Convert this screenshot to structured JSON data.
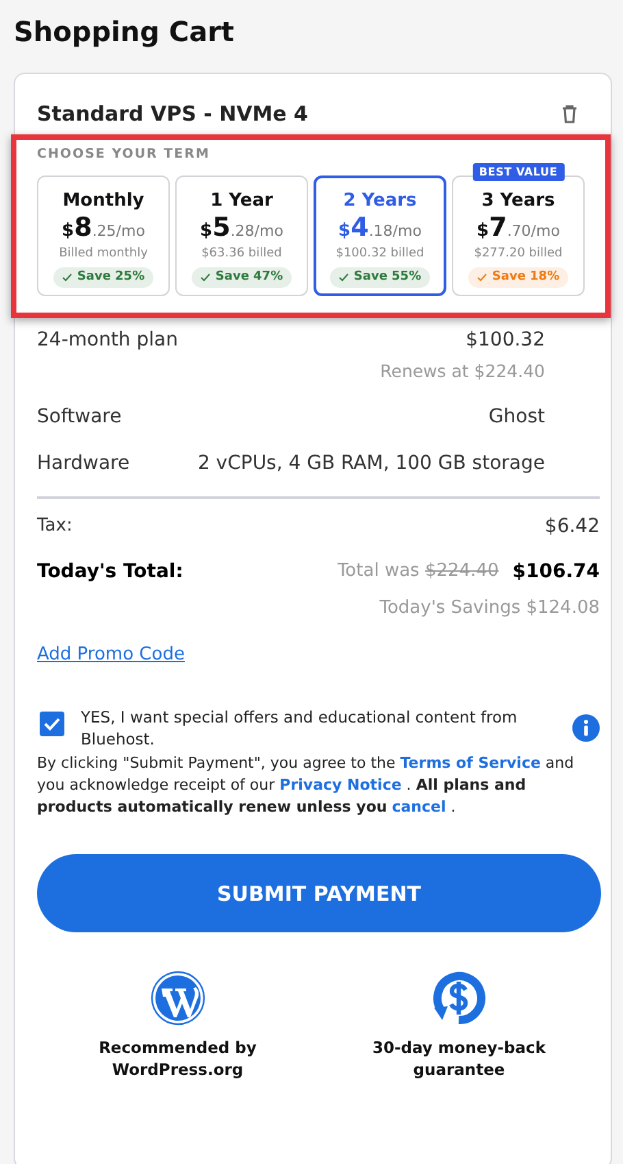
{
  "page_title": "Shopping Cart",
  "product": {
    "name": "Standard VPS - NVMe 4"
  },
  "term_section": {
    "label": "CHOOSE YOUR TERM",
    "highlighted": true
  },
  "terms": [
    {
      "name": "Monthly",
      "currency": "$",
      "whole": "8",
      "rest": ".25/mo",
      "billed": "Billed monthly",
      "savings": {
        "text": "Save 25%",
        "color": "#2e7a3c"
      },
      "selected": false
    },
    {
      "name": "1 Year",
      "currency": "$",
      "whole": "5",
      "rest": ".28/mo",
      "billed": "$63.36 billed",
      "savings": {
        "text": "Save 47%",
        "color": "#2e7a3c"
      },
      "selected": false
    },
    {
      "name": "2 Years",
      "currency": "$",
      "whole": "4",
      "rest": ".18/mo",
      "billed": "$100.32 billed",
      "savings": {
        "text": "Save 55%",
        "color": "#2e7a3c"
      },
      "selected": true
    },
    {
      "name": "3 Years",
      "currency": "$",
      "whole": "7",
      "rest": ".70/mo",
      "billed": "$277.20 billed",
      "savings": {
        "text": "Save 18%",
        "color": "#f07a12"
      },
      "selected": false,
      "badge": "BEST VALUE"
    }
  ],
  "details": [
    {
      "label": "24-month plan",
      "value": "$100.32",
      "note": "Renews at $224.40"
    },
    {
      "label": "Software",
      "value": "Ghost"
    },
    {
      "label": "Hardware",
      "value": "2 vCPUs, 4 GB RAM, 100 GB storage"
    }
  ],
  "tax": {
    "label": "Tax:",
    "value": "$6.42"
  },
  "total": {
    "label": "Today's Total:",
    "was_label": "Total was",
    "was_value": "$224.40",
    "value": "$106.74",
    "savings": "Today's Savings $124.08"
  },
  "promo_link": "Add Promo Code",
  "consent": {
    "checked": true,
    "text": "YES, I want special offers and educational content from Bluehost."
  },
  "legal": [
    {
      "kind": "text",
      "text": " By clicking \"Submit Payment\", you agree to the "
    },
    {
      "kind": "link",
      "text": "Terms of Service"
    },
    {
      "kind": "text",
      "text": " and you acknowledge receipt of our "
    },
    {
      "kind": "link",
      "text": "Privacy Notice"
    },
    {
      "kind": "text",
      "text": " .  **All plans and products automatically renew unless you** "
    },
    {
      "kind": "link",
      "text": "cancel"
    },
    {
      "kind": "text",
      "text": " ."
    }
  ],
  "submit_button": "SUBMIT PAYMENT",
  "badges": [
    {
      "kind": "wordpress",
      "text": "Recommended by WordPress.org"
    },
    {
      "kind": "money",
      "text": "30-day money-back guarantee"
    }
  ]
}
